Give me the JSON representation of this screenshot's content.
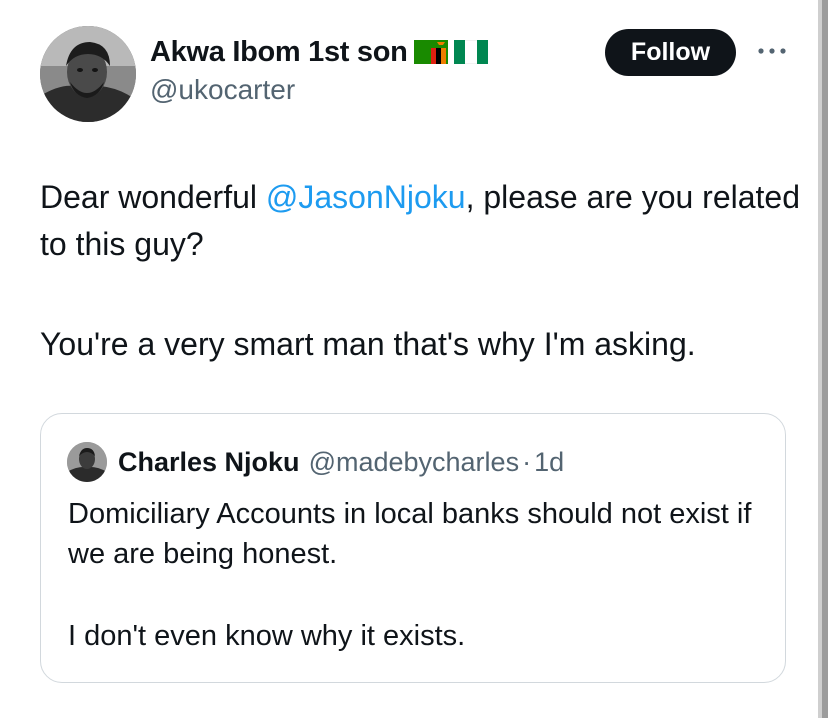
{
  "author": {
    "display_name": "Akwa Ibom 1st son",
    "handle": "@ukocarter",
    "flags": [
      "zambia-flag",
      "nigeria-flag"
    ]
  },
  "actions": {
    "follow_label": "Follow",
    "more_icon": "more-horizontal-icon"
  },
  "tweet": {
    "line1_pre": "Dear wonderful ",
    "mention": "@JasonNjoku",
    "line1_post": ", please are you related to this guy?",
    "paragraph2": "You're a very smart man that's why I'm asking."
  },
  "quoted": {
    "display_name": "Charles Njoku",
    "handle": "@madebycharles",
    "separator": "·",
    "time": "1d",
    "paragraph1": "Domiciliary Accounts in local banks should not exist if we are being honest.",
    "paragraph2": "I don't even know why it exists."
  },
  "colors": {
    "link": "#1d9bf0",
    "text": "#0f1419",
    "muted": "#536471",
    "button": "#0f1419",
    "border": "#d2d8dd"
  }
}
